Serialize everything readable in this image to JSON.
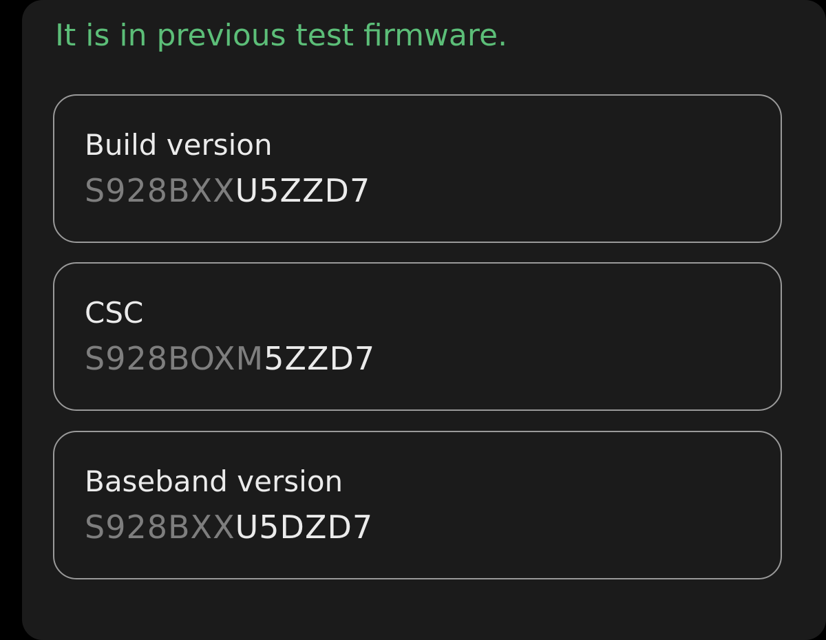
{
  "headline": "It is in previous test firmware.",
  "colors": {
    "headline": "#5cbe78",
    "panel": "#1b1b1b",
    "card_border": "#9a9a9a",
    "value_prefix": "#7e7e7e",
    "value_suffix": "#ebebeb"
  },
  "cards": [
    {
      "title": "Build version",
      "value_prefix": "S928BXX",
      "value_suffix": "U5ZZD7"
    },
    {
      "title": "CSC",
      "value_prefix": "S928BOXM",
      "value_suffix": "5ZZD7"
    },
    {
      "title": "Baseband version",
      "value_prefix": "S928BXX",
      "value_suffix": "U5DZD7"
    }
  ]
}
